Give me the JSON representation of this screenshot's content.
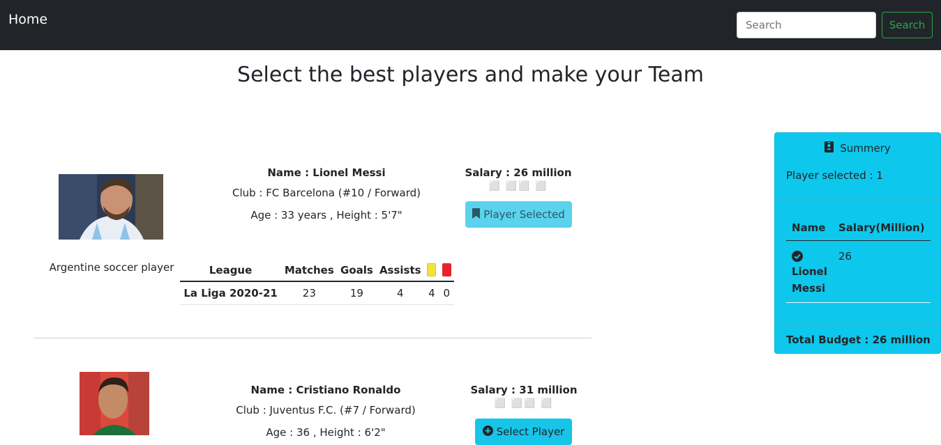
{
  "nav": {
    "brand": "Home",
    "search_placeholder": "Search",
    "search_button": "Search"
  },
  "page": {
    "title": "Select the best players and make your Team"
  },
  "players": [
    {
      "name": "Name : Lionel Messi",
      "club": "Club : FC Barcelona (#10 / Forward)",
      "age_height": "Age : 33 years , Height : 5'7\"",
      "description": "Argentine soccer player",
      "salary": "Salary : 26 million",
      "stars": "⬜ ⬜⬜ ⬜",
      "button": "Player Selected",
      "stats": {
        "headers": [
          "League",
          "Matches",
          "Goals",
          "Assists",
          "yellow-card-icon",
          "red-card-icon"
        ],
        "rows": [
          [
            "La Liga 2020-21",
            "23",
            "19",
            "4",
            "4",
            "0"
          ]
        ]
      }
    },
    {
      "name": "Name : Cristiano Ronaldo",
      "club": "Club : Juventus F.C. (#7 / Forward)",
      "age_height": "Age : 36 , Height : 6'2\"",
      "salary": "Salary : 31 million",
      "stars": "⬜ ⬜⬜ ⬜",
      "button": "Select Player"
    }
  ],
  "summary": {
    "title": "Summery",
    "count": "Player selected : 1",
    "headers": [
      "Name",
      "Salary(Million)"
    ],
    "rows": [
      {
        "name_first": "Lionel",
        "name_last": "Messi",
        "salary": "26"
      }
    ],
    "total": "Total Budget : 26 million"
  },
  "colors": {
    "navbar": "#212529",
    "summary_bg": "#0dc8ec",
    "select_button": "#17c5e8",
    "success": "#28a745"
  }
}
